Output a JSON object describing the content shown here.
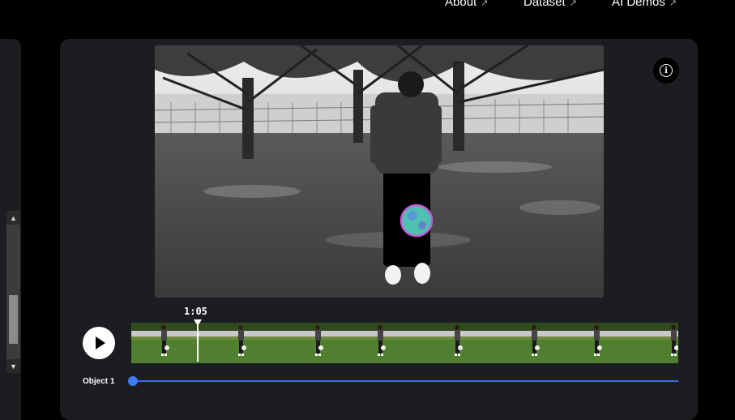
{
  "nav": {
    "items": [
      {
        "label": "About",
        "arrow": "↗"
      },
      {
        "label": "Dataset",
        "arrow": "↗"
      },
      {
        "label": "AI Demos",
        "arrow": "↗"
      }
    ]
  },
  "player": {
    "time": "1:05",
    "object_label": "Object 1",
    "info_glyph": "i",
    "frame_count": 8,
    "icons": [
      "info-icon",
      "play-icon",
      "chevron-up-icon",
      "chevron-down-icon"
    ]
  },
  "scrollbar": {
    "up": "▲",
    "down": "▼"
  },
  "colors": {
    "panel": "#1c1d21",
    "mask": "#4fc1b0",
    "mask_outline": "#c45ad8",
    "track": "#3e7bfa"
  }
}
